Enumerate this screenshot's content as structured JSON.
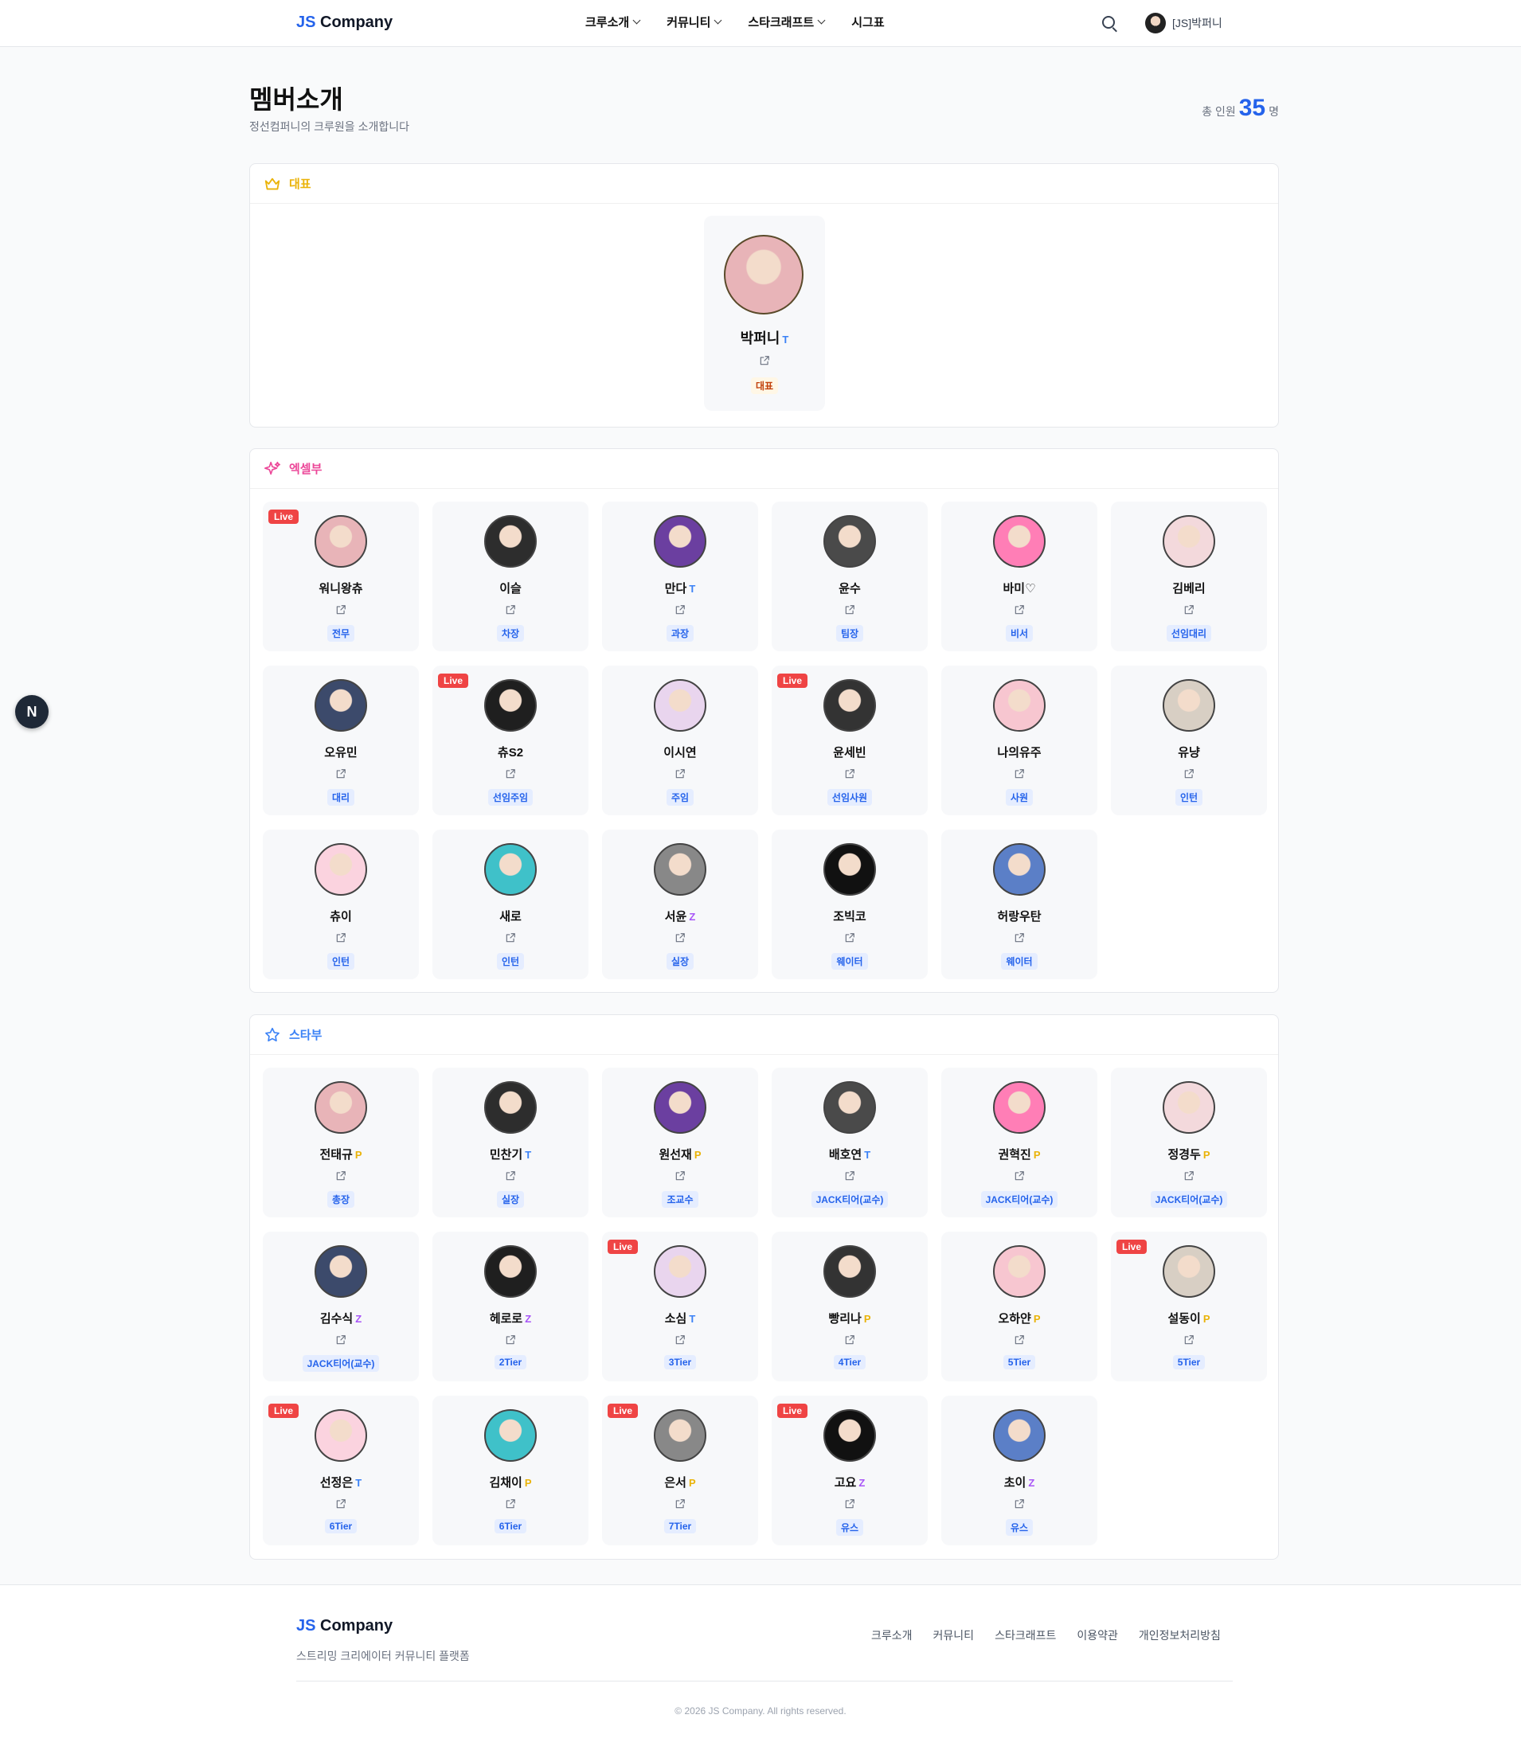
{
  "header": {
    "logo_js": "JS",
    "logo_company": " Company",
    "nav": [
      "크루소개",
      "커뮤니티",
      "스타크래프트",
      "시그표"
    ],
    "user_name": "[JS]박퍼니"
  },
  "page": {
    "title": "멤버소개",
    "subtitle": "정선컴퍼니의 크루원을 소개합니다",
    "total_label": "총 인원",
    "total_count": "35",
    "total_unit": "명"
  },
  "sections": {
    "ceo": {
      "title": "대표",
      "members": [
        {
          "name": "박퍼니",
          "tier": "T",
          "role": "대표"
        }
      ]
    },
    "excel": {
      "title": "엑셀부",
      "members": [
        {
          "name": "워니왕츄",
          "tier": "",
          "role": "전무",
          "live": true
        },
        {
          "name": "이슬",
          "tier": "",
          "role": "차장"
        },
        {
          "name": "만다",
          "tier": "T",
          "role": "과장"
        },
        {
          "name": "윤수",
          "tier": "",
          "role": "팀장"
        },
        {
          "name": "바미♡",
          "tier": "",
          "role": "비서"
        },
        {
          "name": "김베리",
          "tier": "",
          "role": "선임대리"
        },
        {
          "name": "오유민",
          "tier": "",
          "role": "대리"
        },
        {
          "name": "츄S2",
          "tier": "",
          "role": "선임주임",
          "live": true
        },
        {
          "name": "이시연",
          "tier": "",
          "role": "주임"
        },
        {
          "name": "윤세빈",
          "tier": "",
          "role": "선임사원",
          "live": true
        },
        {
          "name": "나의유주",
          "tier": "",
          "role": "사원"
        },
        {
          "name": "유냥",
          "tier": "",
          "role": "인턴"
        },
        {
          "name": "츄이",
          "tier": "",
          "role": "인턴"
        },
        {
          "name": "새로",
          "tier": "",
          "role": "인턴"
        },
        {
          "name": "서윤",
          "tier": "Z",
          "role": "실장"
        },
        {
          "name": "조빅코",
          "tier": "",
          "role": "웨이터"
        },
        {
          "name": "허랑우탄",
          "tier": "",
          "role": "웨이터"
        }
      ]
    },
    "star": {
      "title": "스타부",
      "members": [
        {
          "name": "전태규",
          "tier": "P",
          "role": "총장"
        },
        {
          "name": "민찬기",
          "tier": "T",
          "role": "실장"
        },
        {
          "name": "원선재",
          "tier": "P",
          "role": "조교수"
        },
        {
          "name": "배호연",
          "tier": "T",
          "role": "JACK티어(교수)"
        },
        {
          "name": "권혁진",
          "tier": "P",
          "role": "JACK티어(교수)"
        },
        {
          "name": "정경두",
          "tier": "P",
          "role": "JACK티어(교수)"
        },
        {
          "name": "김수식",
          "tier": "Z",
          "role": "JACK티어(교수)"
        },
        {
          "name": "헤로로",
          "tier": "Z",
          "role": "2Tier"
        },
        {
          "name": "소심",
          "tier": "T",
          "role": "3Tier",
          "live": true
        },
        {
          "name": "빵리나",
          "tier": "P",
          "role": "4Tier"
        },
        {
          "name": "오하얀",
          "tier": "P",
          "role": "5Tier"
        },
        {
          "name": "설동이",
          "tier": "P",
          "role": "5Tier",
          "live": true
        },
        {
          "name": "선정은",
          "tier": "T",
          "role": "6Tier",
          "live": true
        },
        {
          "name": "김채이",
          "tier": "P",
          "role": "6Tier"
        },
        {
          "name": "은서",
          "tier": "P",
          "role": "7Tier",
          "live": true
        },
        {
          "name": "고요",
          "tier": "Z",
          "role": "유스",
          "live": true
        },
        {
          "name": "초이",
          "tier": "Z",
          "role": "유스"
        }
      ]
    }
  },
  "live_label": "Live",
  "fab_label": "N",
  "footer": {
    "logo_js": "JS",
    "logo_company": " Company",
    "tagline": "스트리밍 크리에이터 커뮤니티 플랫폼",
    "links": [
      "크루소개",
      "커뮤니티",
      "스타크래프트",
      "이용약관",
      "개인정보처리방침"
    ],
    "copyright": "© 2026 JS Company. All rights reserved."
  },
  "colors": {
    "accent": "#2563eb",
    "live": "#ef4444",
    "ceo_title": "#eab308",
    "excel_title": "#ec4899",
    "star_title": "#3b82f6"
  }
}
